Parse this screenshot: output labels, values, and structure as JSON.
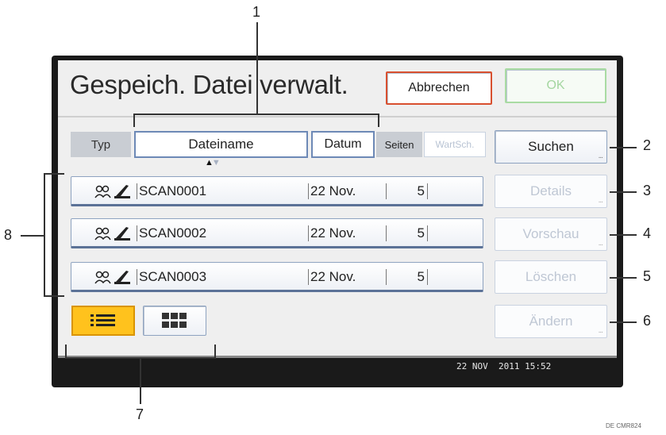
{
  "window": {
    "title": "Gespeich. Datei verwalt."
  },
  "toolbar": {
    "cancel_label": "Abbrechen",
    "ok_label": "OK"
  },
  "columns": {
    "type": "Typ",
    "name": "Dateiname",
    "date": "Datum",
    "pages": "Seiten",
    "waiting": "WartSch."
  },
  "files": [
    {
      "name": "SCAN0001",
      "date": "22 Nov.",
      "pages": "5"
    },
    {
      "name": "SCAN0002",
      "date": "22 Nov.",
      "pages": "5"
    },
    {
      "name": "SCAN0003",
      "date": "22 Nov.",
      "pages": "5"
    }
  ],
  "actions": {
    "search": "Suchen",
    "details": "Details",
    "preview": "Vorschau",
    "delete": "Löschen",
    "change": "Ändern",
    "dots": "..."
  },
  "status": {
    "datetime": "22 NOV  2011 15:52"
  },
  "callouts": [
    "1",
    "2",
    "3",
    "4",
    "5",
    "6",
    "7",
    "8"
  ],
  "figure_code": "DE CMR824",
  "icons": {
    "file_type": "scanner-file-icon",
    "list_view": "list-view-icon",
    "thumbnail_view": "thumbnail-grid-icon"
  },
  "colors": {
    "cancel_border": "#d8502f",
    "ok_disabled": "#a4d6a0",
    "list_view_active": "#ffc21d",
    "accent_border": "#6d89b6"
  }
}
